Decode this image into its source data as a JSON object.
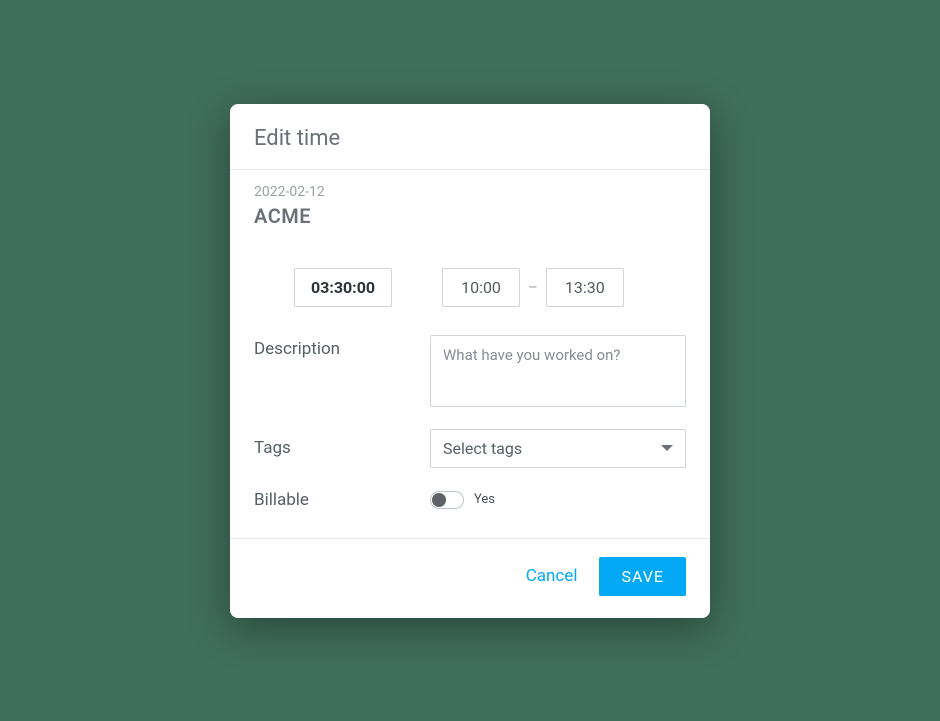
{
  "modal": {
    "title": "Edit time",
    "date": "2022-02-12",
    "project": "ACME",
    "duration": "03:30:00",
    "start_time": "10:00",
    "end_time": "13:30",
    "description_label": "Description",
    "description_placeholder": "What have you worked on?",
    "description_value": "",
    "tags_label": "Tags",
    "tags_placeholder": "Select tags",
    "billable_label": "Billable",
    "billable_value_label": "Yes",
    "billable_on": false,
    "cancel_label": "Cancel",
    "save_label": "SAVE"
  },
  "colors": {
    "accent": "#03a9f4",
    "backdrop": "#3f6e5a",
    "border": "#cfd4da",
    "text_muted": "#9aa0a6"
  }
}
